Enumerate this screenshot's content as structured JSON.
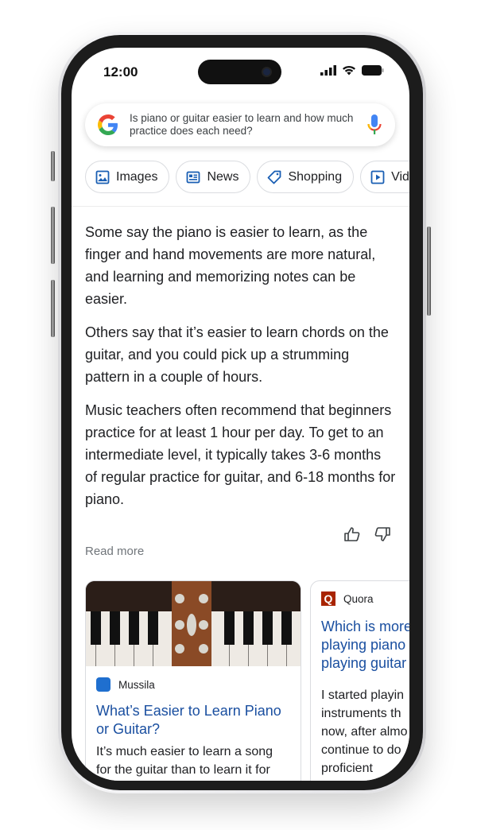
{
  "status_bar": {
    "time": "12:00"
  },
  "search": {
    "query": "Is piano or guitar easier to learn and how much practice does each need?"
  },
  "chips": [
    {
      "label": "Images",
      "icon": "image-icon"
    },
    {
      "label": "News",
      "icon": "news-icon"
    },
    {
      "label": "Shopping",
      "icon": "tag-icon"
    },
    {
      "label": "Videos",
      "icon": "play-icon"
    }
  ],
  "answer": {
    "paragraphs": [
      "Some say the piano is easier to learn, as the finger and hand movements are more natural, and learning and memorizing notes can be easier.",
      "Others say that it’s easier to learn chords on the guitar, and you could pick up a strumming pattern in a couple of hours.",
      "Music teachers often recommend that beginners practice for at least 1 hour per day. To get to an intermediate level, it typically takes 3-6 months of regular practice for guitar, and 6-18 months for piano."
    ],
    "read_more": "Read more"
  },
  "cards": [
    {
      "source": "Mussila",
      "title": "What’s Easier to Learn Piano or Guitar?",
      "snippet": "It’s much easier to learn a song for the guitar than to learn it for"
    },
    {
      "source": "Quora",
      "source_logo": "Q",
      "title": "Which is more playing piano playing guitar",
      "snippet": "I started playin instruments th now, after almo continue to do proficient"
    }
  ],
  "colors": {
    "link": "#1a4fa0",
    "quora": "#a82400",
    "chip_icon": "#1a5fb4"
  }
}
